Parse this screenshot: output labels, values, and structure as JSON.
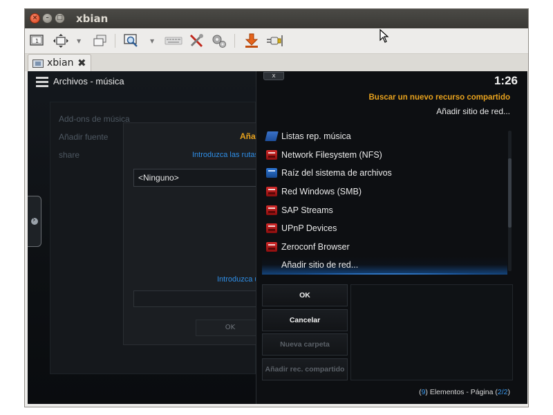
{
  "window": {
    "title": "xbian",
    "controls": {
      "close": "×",
      "minimize": "–",
      "maximize": "□"
    }
  },
  "toolbar": {
    "icons": [
      "screen-icon",
      "fullscreen-icon",
      "windows-icon",
      "zoom-icon",
      "keyboard-icon",
      "tools-icon",
      "gears-icon",
      "download-icon",
      "plug-icon"
    ]
  },
  "tab": {
    "label": "xbian",
    "close": "✖"
  },
  "left_pane": {
    "header": "Archivos - música",
    "list": [
      "Add-ons de música",
      "Añadir fuente",
      "share"
    ],
    "dialog_title": "Aña",
    "hint_top": "Introduzca las rutas",
    "input_value": "<Ninguno>",
    "hint_bottom": "Introduzca u",
    "ok_label": "OK"
  },
  "right_pane": {
    "close_label": "x",
    "clock": "1:26",
    "heading": "Buscar un nuevo recurso compartido",
    "subheading": "Añadir sitio de red...",
    "items": [
      {
        "label": "Listas rep. música",
        "icon": "playlist-folder-icon"
      },
      {
        "label": "Network Filesystem (NFS)",
        "icon": "network-drive-icon"
      },
      {
        "label": "Raíz del sistema de archivos",
        "icon": "root-drive-icon"
      },
      {
        "label": "Red Windows (SMB)",
        "icon": "network-drive-icon"
      },
      {
        "label": "SAP Streams",
        "icon": "network-drive-icon"
      },
      {
        "label": "UPnP Devices",
        "icon": "network-drive-icon"
      },
      {
        "label": "Zeroconf Browser",
        "icon": "network-drive-icon"
      },
      {
        "label": "Añadir sitio de red...",
        "icon": ""
      }
    ],
    "buttons": {
      "ok": "OK",
      "cancel": "Cancelar",
      "new_folder": "Nueva carpeta",
      "add_share": "Añadir rec. compartido"
    },
    "footer": {
      "count": "9",
      "elements_label": "Elementos - Página",
      "page": "2/2"
    }
  }
}
